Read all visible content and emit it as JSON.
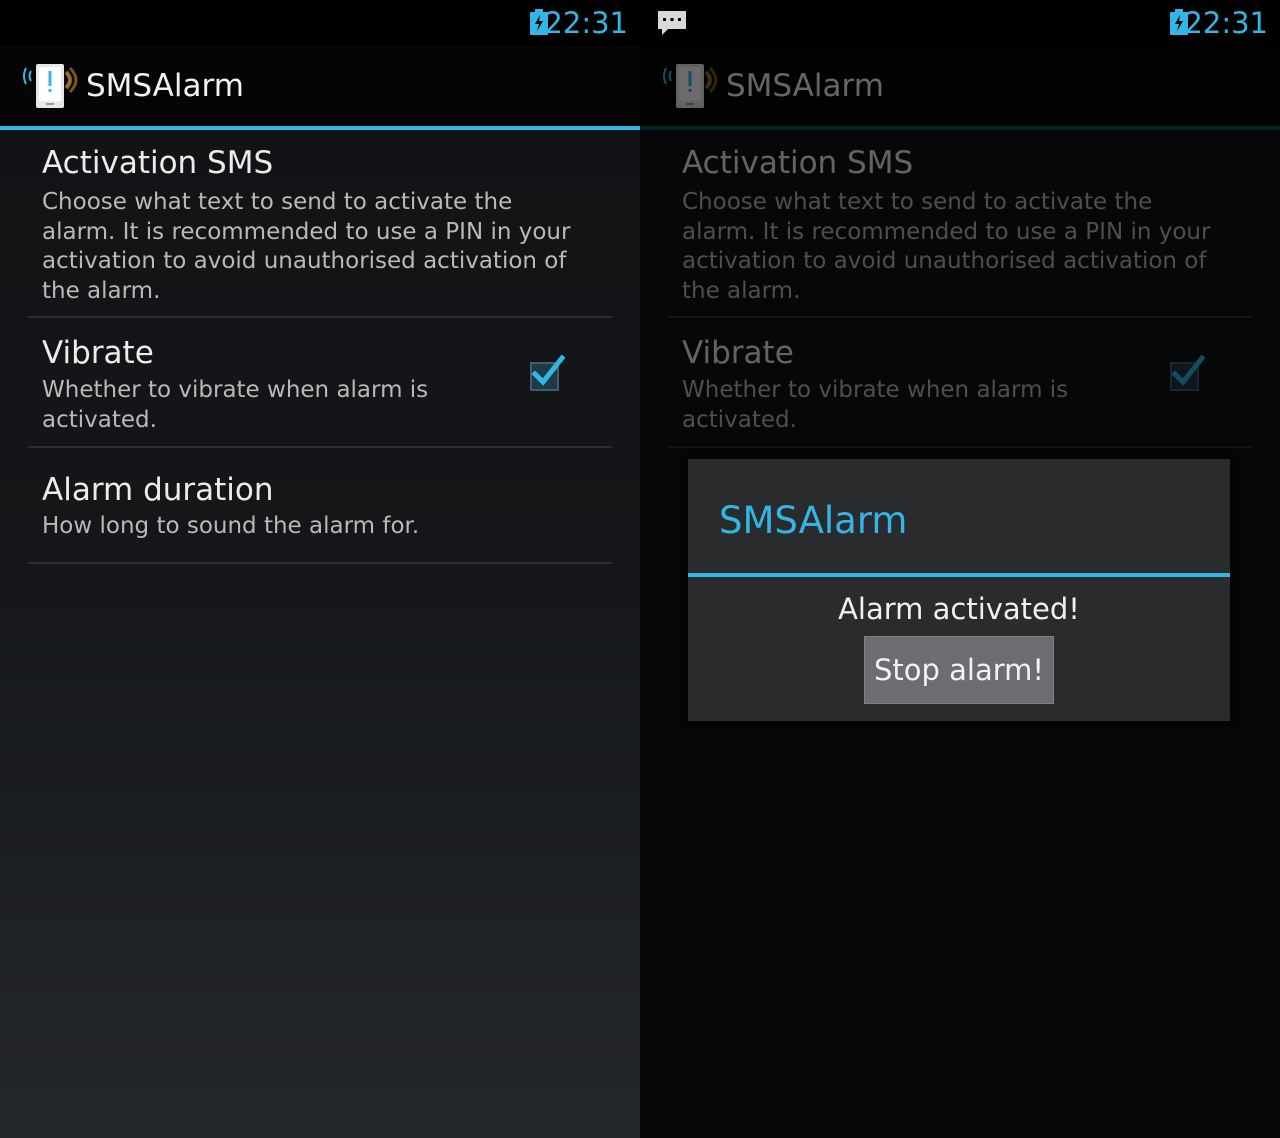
{
  "status_bar": {
    "time": "22:31"
  },
  "app": {
    "title": "SMSAlarm"
  },
  "preferences": [
    {
      "title": "Activation SMS",
      "summary": "Choose what text to send to activate the alarm. It is recommended to use a PIN in your activation to avoid unauthorised activation of the alarm."
    },
    {
      "title": "Vibrate",
      "summary": "Whether to vibrate when alarm is activated.",
      "checked": true
    },
    {
      "title": "Alarm duration",
      "summary": "How long to sound the alarm for."
    }
  ],
  "dialog": {
    "title": "SMSAlarm",
    "message": "Alarm activated!",
    "button_label": "Stop alarm!"
  },
  "colors": {
    "accent": "#33b5e5",
    "background": "#101113"
  },
  "icons": [
    "battery-charging-icon",
    "sms-notification-icon",
    "app-icon",
    "checkbox-checked-icon"
  ]
}
